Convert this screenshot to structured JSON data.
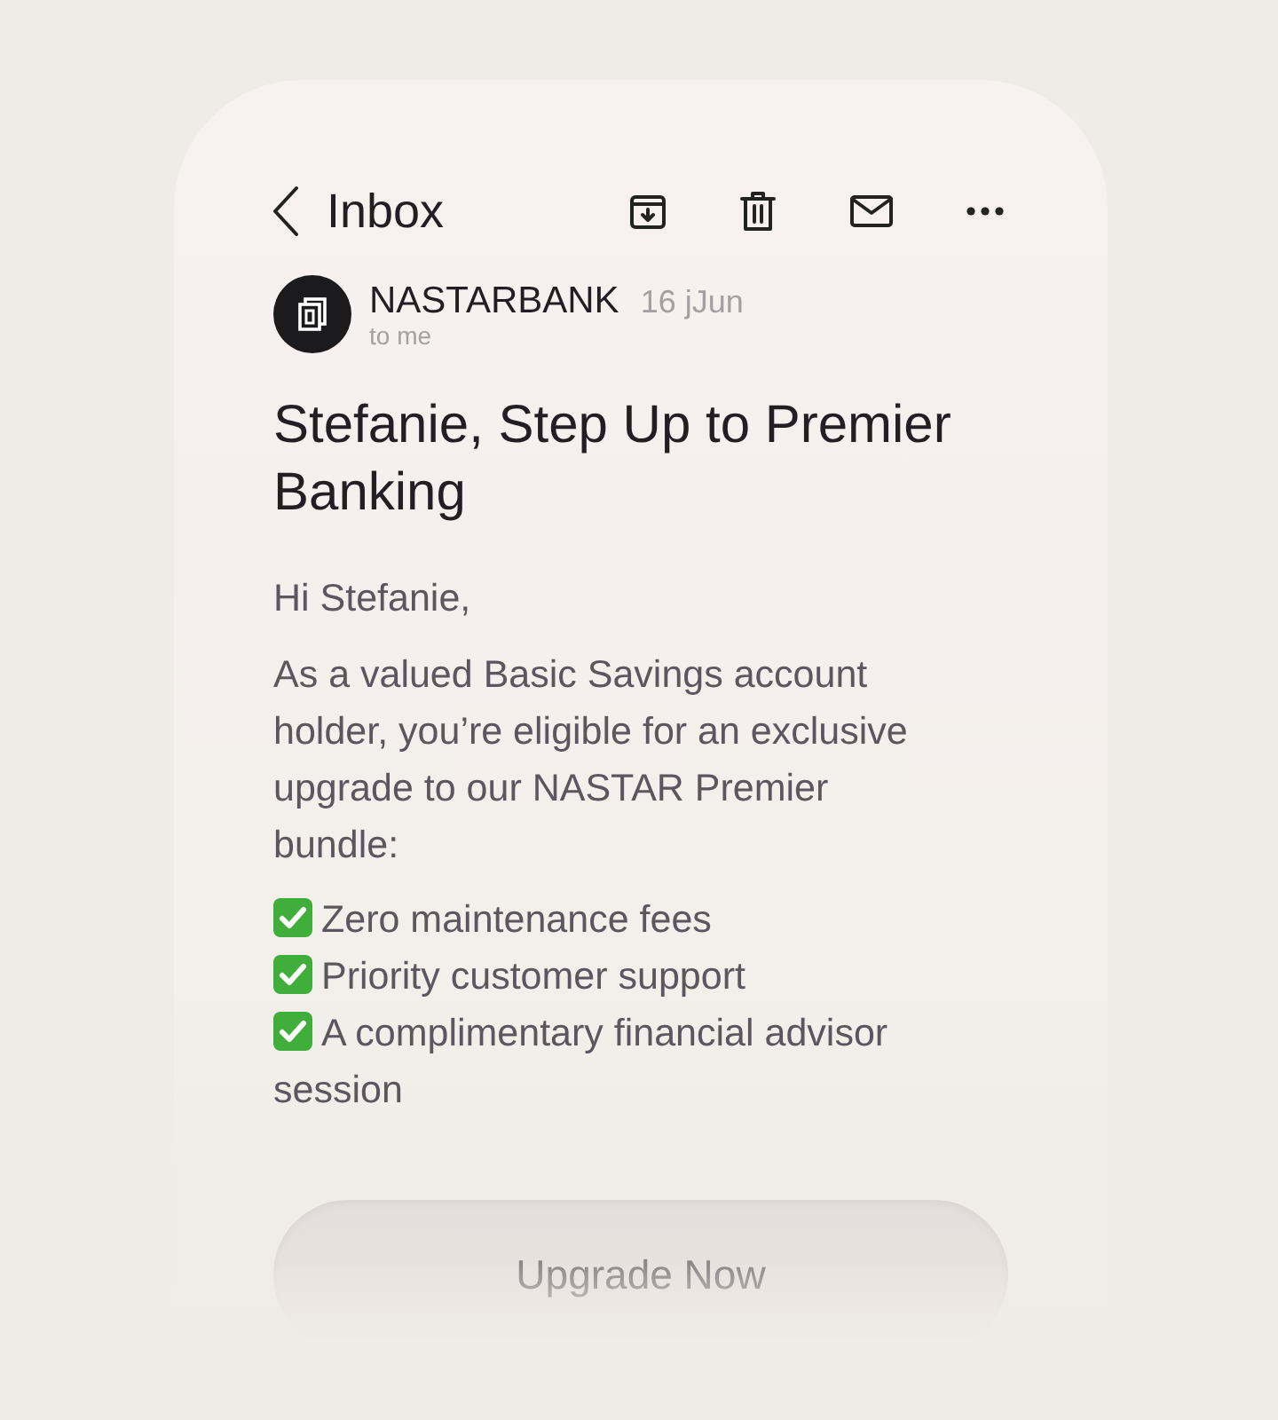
{
  "header": {
    "title": "Inbox"
  },
  "sender": {
    "name": "NASTARBANK",
    "date": "16 jJun",
    "recipient": "to me"
  },
  "subject": "Stefanie, Step Up to Premier Banking",
  "greeting": "Hi Stefanie,",
  "body": "As a valued Basic Savings account holder, you’re eligible for an exclusive upgrade to our NASTAR Premier bundle:",
  "benefits": [
    {
      "text": "Zero maintenance fees",
      "checked": true
    },
    {
      "text": "Priority customer support",
      "checked": true
    },
    {
      "text": "A complimentary financial advisor session",
      "checked": true
    }
  ],
  "button": {
    "label": "Upgrade Now"
  }
}
